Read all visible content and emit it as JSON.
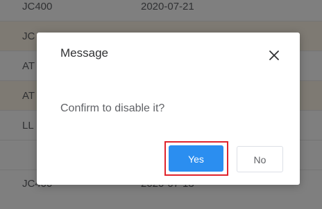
{
  "table": {
    "rows": [
      {
        "model": "JC400",
        "date": "2020-07-21",
        "tinted": false
      },
      {
        "model": "JC",
        "date": "",
        "tinted": true
      },
      {
        "model": "AT",
        "date": "",
        "tinted": false
      },
      {
        "model": "AT",
        "date": "",
        "tinted": true
      },
      {
        "model": "LL",
        "date": "",
        "tinted": false
      },
      {
        "model": "JC400",
        "date": "2020-07-13",
        "tinted": false
      }
    ]
  },
  "dialog": {
    "title": "Message",
    "close_icon": "close-icon",
    "message": "Confirm to disable it?",
    "confirm_label": "Yes",
    "cancel_label": "No"
  },
  "colors": {
    "primary": "#2b8ef0",
    "highlight": "#e0232b",
    "row_tint": "#fdf5e6"
  }
}
